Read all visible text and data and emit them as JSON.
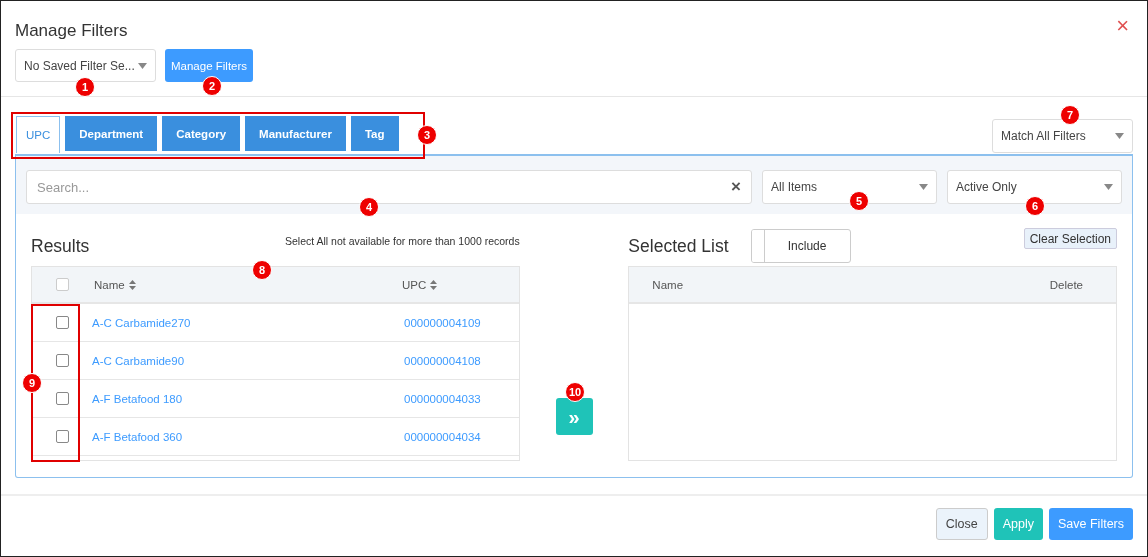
{
  "dialog": {
    "title": "Manage Filters",
    "close": "×"
  },
  "saved_filter": {
    "value": "No Saved Filter Se..."
  },
  "manage_button": "Manage Filters",
  "tabs": [
    {
      "label": "UPC",
      "selected": true
    },
    {
      "label": "Department",
      "selected": false
    },
    {
      "label": "Category",
      "selected": false
    },
    {
      "label": "Manufacturer",
      "selected": false
    },
    {
      "label": "Tag",
      "selected": false
    }
  ],
  "match_select": {
    "value": "Match All Filters"
  },
  "search": {
    "placeholder": "Search...",
    "clear": "×"
  },
  "item_filter": {
    "value": "All Items"
  },
  "status_filter": {
    "value": "Active Only"
  },
  "results": {
    "title": "Results",
    "note": "Select All not available for more than 1000 records",
    "select_all_checked": false,
    "columns": [
      "Name",
      "UPC"
    ],
    "rows": [
      {
        "name": "A-C Carbamide270",
        "upc": "000000004109",
        "checked": false
      },
      {
        "name": "A-C Carbamide90",
        "upc": "000000004108",
        "checked": false
      },
      {
        "name": "A-F Betafood 180",
        "upc": "000000004033",
        "checked": false
      },
      {
        "name": "A-F Betafood 360",
        "upc": "000000004034",
        "checked": false
      }
    ]
  },
  "move_button": "»",
  "selected_list": {
    "title": "Selected List",
    "include_toggle": {
      "label": "Include",
      "on": false
    },
    "clear_button": "Clear Selection",
    "columns": [
      "Name",
      "Delete"
    ]
  },
  "footer_buttons": [
    {
      "label": "Close",
      "kind": "secondary"
    },
    {
      "label": "Apply",
      "kind": "success"
    },
    {
      "label": "Save Filters",
      "kind": "primary"
    }
  ],
  "callouts": [
    "1",
    "2",
    "3",
    "4",
    "5",
    "6",
    "7",
    "8",
    "9",
    "10"
  ]
}
